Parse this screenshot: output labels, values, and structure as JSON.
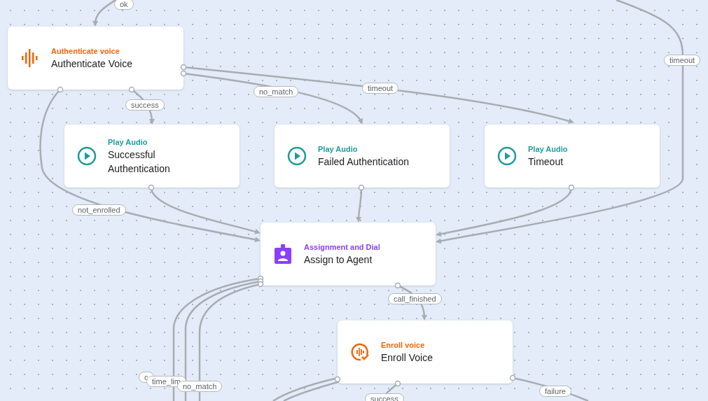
{
  "nodes": [
    {
      "kind": "voice_auth",
      "category": "Authenticate voice",
      "title": "Authenticate Voice"
    },
    {
      "kind": "play_audio",
      "category": "Play Audio",
      "title": "Successful Authentication"
    },
    {
      "kind": "play_audio",
      "category": "Play Audio",
      "title": "Failed Authentication"
    },
    {
      "kind": "play_audio",
      "category": "Play Audio",
      "title": "Timeout"
    },
    {
      "kind": "assignment",
      "category": "Assignment and Dial",
      "title": "Assign to Agent"
    },
    {
      "kind": "enroll",
      "category": "Enroll voice",
      "title": "Enroll Voice"
    }
  ],
  "edge_labels": [
    "ok",
    "success",
    "not_enrolled",
    "no_match",
    "timeout",
    "timeout",
    "call_finished",
    "c",
    "time_lim",
    "no_match",
    "success",
    "failure"
  ]
}
